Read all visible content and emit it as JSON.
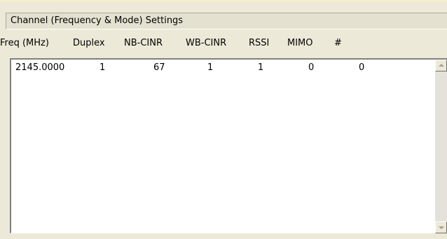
{
  "group": {
    "title": "Channel (Frequency & Mode) Settings"
  },
  "columns": [
    "Freq (MHz)",
    "Duplex",
    "NB-CINR",
    "WB-CINR",
    "RSSI",
    "MIMO",
    "#"
  ],
  "rows": [
    [
      "2145.0000",
      "1",
      "67",
      "1",
      "1",
      "0",
      "0"
    ]
  ],
  "icons": {
    "scroll_up": "scroll-up-arrow-icon",
    "scroll_down": "scroll-down-arrow-icon"
  },
  "colors": {
    "panel_background": "#ece9d8",
    "list_background": "#ffffff",
    "header_background": "#e4e1d0"
  }
}
